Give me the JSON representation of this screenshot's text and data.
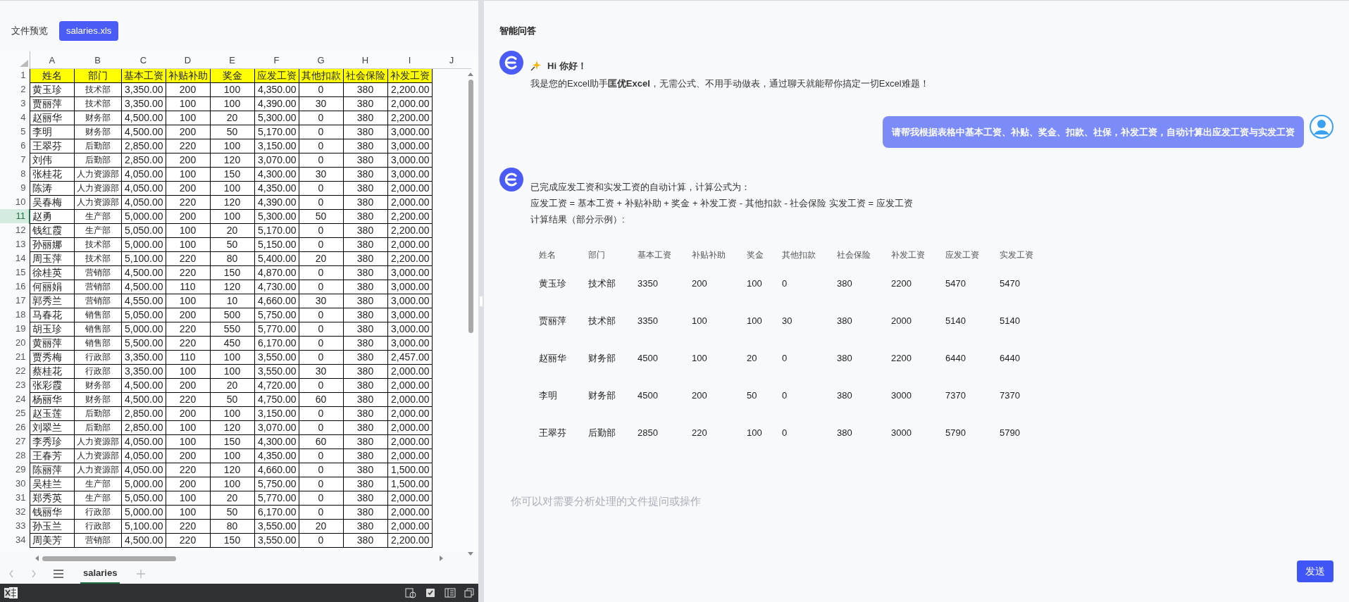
{
  "preview": {
    "label": "文件预览",
    "file_tab": "salaries.xls"
  },
  "sheet": {
    "column_headers": [
      "A",
      "B",
      "C",
      "D",
      "E",
      "F",
      "G",
      "H",
      "I",
      "J"
    ],
    "rows": [
      {
        "number": "1",
        "kind": "header",
        "selected": false,
        "cells": [
          "姓名",
          "部门",
          "基本工资",
          "补贴补助",
          "奖金",
          "应发工资",
          "其他扣款",
          "社会保险",
          "补发工资"
        ]
      },
      {
        "number": "2",
        "kind": "data",
        "selected": false,
        "cells": [
          "黄玉珍",
          "技术部",
          "3,350.00",
          "200",
          "100",
          "4,350.00",
          "0",
          "380",
          "2,200.00"
        ]
      },
      {
        "number": "3",
        "kind": "data",
        "selected": false,
        "cells": [
          "贾丽萍",
          "技术部",
          "3,350.00",
          "100",
          "100",
          "4,390.00",
          "30",
          "380",
          "2,000.00"
        ]
      },
      {
        "number": "4",
        "kind": "data",
        "selected": false,
        "cells": [
          "赵丽华",
          "财务部",
          "4,500.00",
          "100",
          "20",
          "5,300.00",
          "0",
          "380",
          "2,200.00"
        ]
      },
      {
        "number": "5",
        "kind": "data",
        "selected": false,
        "cells": [
          "李明",
          "财务部",
          "4,500.00",
          "200",
          "50",
          "5,170.00",
          "0",
          "380",
          "3,000.00"
        ]
      },
      {
        "number": "6",
        "kind": "data",
        "selected": false,
        "cells": [
          "王翠芬",
          "后勤部",
          "2,850.00",
          "220",
          "100",
          "3,150.00",
          "0",
          "380",
          "3,000.00"
        ]
      },
      {
        "number": "7",
        "kind": "data",
        "selected": false,
        "cells": [
          "刘伟",
          "后勤部",
          "2,850.00",
          "200",
          "120",
          "3,070.00",
          "0",
          "380",
          "3,000.00"
        ]
      },
      {
        "number": "8",
        "kind": "data",
        "selected": false,
        "cells": [
          "张桂花",
          "人力资源部",
          "4,050.00",
          "100",
          "150",
          "4,300.00",
          "30",
          "380",
          "3,000.00"
        ]
      },
      {
        "number": "9",
        "kind": "data",
        "selected": false,
        "cells": [
          "陈涛",
          "人力资源部",
          "4,050.00",
          "200",
          "100",
          "4,350.00",
          "0",
          "380",
          "2,000.00"
        ]
      },
      {
        "number": "10",
        "kind": "data",
        "selected": false,
        "cells": [
          "吴春梅",
          "人力资源部",
          "4,050.00",
          "220",
          "120",
          "4,390.00",
          "0",
          "380",
          "2,000.00"
        ]
      },
      {
        "number": "11",
        "kind": "data",
        "selected": true,
        "cells": [
          "赵勇",
          "生产部",
          "5,000.00",
          "200",
          "100",
          "5,300.00",
          "50",
          "380",
          "2,200.00"
        ]
      },
      {
        "number": "12",
        "kind": "data",
        "selected": false,
        "cells": [
          "钱红霞",
          "生产部",
          "5,050.00",
          "100",
          "20",
          "5,170.00",
          "0",
          "380",
          "2,200.00"
        ]
      },
      {
        "number": "13",
        "kind": "data",
        "selected": false,
        "cells": [
          "孙丽娜",
          "技术部",
          "5,000.00",
          "100",
          "50",
          "5,150.00",
          "0",
          "380",
          "2,000.00"
        ]
      },
      {
        "number": "14",
        "kind": "data",
        "selected": false,
        "cells": [
          "周玉萍",
          "技术部",
          "5,100.00",
          "220",
          "80",
          "5,400.00",
          "20",
          "380",
          "2,200.00"
        ]
      },
      {
        "number": "15",
        "kind": "data",
        "selected": false,
        "cells": [
          "徐桂英",
          "营销部",
          "4,500.00",
          "220",
          "150",
          "4,870.00",
          "0",
          "380",
          "3,000.00"
        ]
      },
      {
        "number": "16",
        "kind": "data",
        "selected": false,
        "cells": [
          "何丽娟",
          "营销部",
          "4,500.00",
          "110",
          "120",
          "4,730.00",
          "0",
          "380",
          "3,000.00"
        ]
      },
      {
        "number": "17",
        "kind": "data",
        "selected": false,
        "cells": [
          "郭秀兰",
          "营销部",
          "4,550.00",
          "100",
          "10",
          "4,660.00",
          "30",
          "380",
          "3,000.00"
        ]
      },
      {
        "number": "18",
        "kind": "data",
        "selected": false,
        "cells": [
          "马春花",
          "销售部",
          "5,050.00",
          "200",
          "500",
          "5,750.00",
          "0",
          "380",
          "3,000.00"
        ]
      },
      {
        "number": "19",
        "kind": "data",
        "selected": false,
        "cells": [
          "胡玉珍",
          "销售部",
          "5,000.00",
          "220",
          "550",
          "5,770.00",
          "0",
          "380",
          "3,000.00"
        ]
      },
      {
        "number": "20",
        "kind": "data",
        "selected": false,
        "cells": [
          "黄丽萍",
          "销售部",
          "5,500.00",
          "220",
          "450",
          "6,170.00",
          "0",
          "380",
          "3,000.00"
        ]
      },
      {
        "number": "21",
        "kind": "data",
        "selected": false,
        "cells": [
          "贾秀梅",
          "行政部",
          "3,350.00",
          "110",
          "100",
          "3,550.00",
          "0",
          "380",
          "2,457.00"
        ]
      },
      {
        "number": "22",
        "kind": "data",
        "selected": false,
        "cells": [
          "蔡桂花",
          "行政部",
          "3,350.00",
          "100",
          "100",
          "3,550.00",
          "30",
          "380",
          "2,000.00"
        ]
      },
      {
        "number": "23",
        "kind": "data",
        "selected": false,
        "cells": [
          "张彩霞",
          "财务部",
          "4,500.00",
          "200",
          "20",
          "4,720.00",
          "0",
          "380",
          "2,000.00"
        ]
      },
      {
        "number": "24",
        "kind": "data",
        "selected": false,
        "cells": [
          "杨丽华",
          "财务部",
          "4,500.00",
          "220",
          "50",
          "4,750.00",
          "60",
          "380",
          "2,000.00"
        ]
      },
      {
        "number": "25",
        "kind": "data",
        "selected": false,
        "cells": [
          "赵玉莲",
          "后勤部",
          "2,850.00",
          "200",
          "100",
          "3,150.00",
          "0",
          "380",
          "2,000.00"
        ]
      },
      {
        "number": "26",
        "kind": "data",
        "selected": false,
        "cells": [
          "刘翠兰",
          "后勤部",
          "2,850.00",
          "100",
          "120",
          "3,070.00",
          "0",
          "380",
          "2,000.00"
        ]
      },
      {
        "number": "27",
        "kind": "data",
        "selected": false,
        "cells": [
          "李秀珍",
          "人力资源部",
          "4,050.00",
          "100",
          "150",
          "4,300.00",
          "60",
          "380",
          "2,000.00"
        ]
      },
      {
        "number": "28",
        "kind": "data",
        "selected": false,
        "cells": [
          "王春芳",
          "人力资源部",
          "4,050.00",
          "200",
          "100",
          "4,350.00",
          "0",
          "380",
          "2,000.00"
        ]
      },
      {
        "number": "29",
        "kind": "data",
        "selected": false,
        "cells": [
          "陈丽萍",
          "人力资源部",
          "4,050.00",
          "220",
          "120",
          "4,660.00",
          "0",
          "380",
          "1,500.00"
        ]
      },
      {
        "number": "30",
        "kind": "data",
        "selected": false,
        "cells": [
          "吴桂兰",
          "生产部",
          "5,000.00",
          "200",
          "100",
          "5,750.00",
          "0",
          "380",
          "1,500.00"
        ]
      },
      {
        "number": "31",
        "kind": "data",
        "selected": false,
        "cells": [
          "郑秀英",
          "生产部",
          "5,050.00",
          "100",
          "20",
          "5,770.00",
          "0",
          "380",
          "2,000.00"
        ]
      },
      {
        "number": "32",
        "kind": "data",
        "selected": false,
        "cells": [
          "钱丽华",
          "行政部",
          "5,000.00",
          "100",
          "50",
          "6,170.00",
          "0",
          "380",
          "2,000.00"
        ]
      },
      {
        "number": "33",
        "kind": "data",
        "selected": false,
        "cells": [
          "孙玉兰",
          "行政部",
          "5,100.00",
          "220",
          "80",
          "3,550.00",
          "20",
          "380",
          "2,000.00"
        ]
      },
      {
        "number": "34",
        "kind": "data",
        "selected": false,
        "cells": [
          "周美芳",
          "营销部",
          "4,500.00",
          "220",
          "150",
          "3,550.00",
          "0",
          "380",
          "2,200.00"
        ]
      }
    ],
    "sheet_tabs": [
      {
        "label": "salaries",
        "selected": true
      }
    ]
  },
  "chat": {
    "title": "智能问答",
    "messages": [
      {
        "kind": "assistant",
        "greeting": "Hi 你好！",
        "text": "我是您的Excel助手**匡优Excel**，无需公式、不用手动做表，通过聊天就能帮你搞定一切Excel难题！"
      },
      {
        "kind": "user",
        "text": "请帮我根据表格中基本工资、补贴、奖金、扣款、社保，补发工资，自动计算出应发工资与实发工资"
      },
      {
        "kind": "assistant",
        "lines": [
          "已完成应发工资和实发工资的自动计算，计算公式为：",
          "应发工资 = 基本工资 + 补贴补助 + 奖金 + 补发工资 - 其他扣款 - 社会保险 实发工资 = 应发工资",
          "计算结果（部分示例）:"
        ],
        "table": {
          "columns": [
            "姓名",
            "部门",
            "基本工资",
            "补贴补助",
            "奖金",
            "其他扣款",
            "社会保险",
            "补发工资",
            "应发工资",
            "实发工资"
          ],
          "rows": [
            [
              "黄玉珍",
              "技术部",
              "3350",
              "200",
              "100",
              "0",
              "380",
              "2200",
              "5470",
              "5470"
            ],
            [
              "贾丽萍",
              "技术部",
              "3350",
              "100",
              "100",
              "30",
              "380",
              "2000",
              "5140",
              "5140"
            ],
            [
              "赵丽华",
              "财务部",
              "4500",
              "100",
              "20",
              "0",
              "380",
              "2200",
              "6440",
              "6440"
            ],
            [
              "李明",
              "财务部",
              "4500",
              "200",
              "50",
              "0",
              "380",
              "3000",
              "7370",
              "7370"
            ],
            [
              "王翠芬",
              "后勤部",
              "2850",
              "220",
              "100",
              "0",
              "380",
              "3000",
              "5790",
              "5790"
            ]
          ]
        }
      }
    ],
    "input": {
      "placeholder": "你可以对需要分析处理的文件提问或操作"
    },
    "send_button": "发送"
  }
}
